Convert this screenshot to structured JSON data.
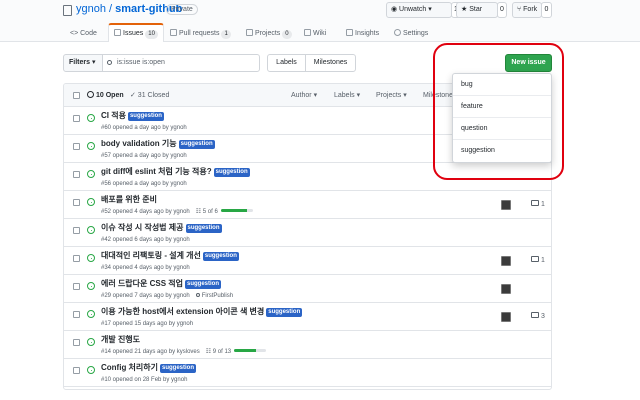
{
  "repo": {
    "owner": "ygnoh",
    "sep": " / ",
    "name": "smart-github",
    "visibility": "Private"
  },
  "header_buttons": {
    "unwatch": "◉ Unwatch ▾",
    "unwatch_count": "1",
    "star": "★ Star",
    "star_count": "0",
    "fork": "⑂ Fork",
    "fork_count": "0"
  },
  "tabs": [
    {
      "label": "<> Code",
      "icon": "code-icon"
    },
    {
      "label": "Issues",
      "count": "10",
      "icon": "issue-icon"
    },
    {
      "label": "Pull requests",
      "count": "1",
      "icon": "pr-icon"
    },
    {
      "label": "Projects",
      "count": "0",
      "icon": "project-icon"
    },
    {
      "label": "Wiki",
      "icon": "wiki-icon"
    },
    {
      "label": "Insights",
      "icon": "graph-icon"
    },
    {
      "label": "Settings",
      "icon": "gear-icon"
    }
  ],
  "toolbar": {
    "filters": "Filters ▾",
    "search_value": "is:issue is:open",
    "labels": "Labels",
    "milestones": "Milestones",
    "new_issue": "New issue"
  },
  "list_header": {
    "open": "10 Open",
    "closed": "✓ 31 Closed",
    "author": "Author ▾",
    "labels": "Labels ▾",
    "projects": "Projects ▾",
    "milestones": "Milestone"
  },
  "issues": [
    {
      "title": "CI 적용",
      "label": "suggestion",
      "meta": "#60 opened a day ago by ygnoh"
    },
    {
      "title": "body validation 기능",
      "label": "suggestion",
      "meta": "#57 opened a day ago by ygnoh"
    },
    {
      "title": "git diff에 eslint 처럼 기능 적용?",
      "label": "suggestion",
      "meta": "#56 opened a day ago by ygnoh"
    },
    {
      "title": "배포를 위한 준비",
      "label": "",
      "meta": "#52 opened 4 days ago by ygnoh",
      "progress": "5 of 6",
      "progress_frac": 0.83,
      "comments": "1"
    },
    {
      "title": "이슈 작성 시 작성법 제공",
      "label": "suggestion",
      "meta": "#42 opened 6 days ago by ygnoh"
    },
    {
      "title": "대대적인 리팩토링 - 설계 개선",
      "label": "suggestion",
      "meta": "#34 opened 4 days ago by ygnoh",
      "comments": "1"
    },
    {
      "title": "에러 드랍다운 CSS 적업",
      "label": "suggestion",
      "meta": "#29 opened 7 days ago by ygnoh",
      "milestone": "FirstPublish"
    },
    {
      "title": "이용 가능한 host에서 extension 아이콘 색 변경",
      "label": "suggestion",
      "meta": "#17 opened 15 days ago by ygnoh",
      "comments": "3"
    },
    {
      "title": "개발 진행도",
      "label": "",
      "meta": "#14 opened 21 days ago by kysloves",
      "progress": "9 of 13",
      "progress_frac": 0.69
    },
    {
      "title": "Config 처리하기",
      "label": "suggestion",
      "meta": "#10 opened on 28 Feb by ygnoh"
    }
  ],
  "label_menu": [
    "bug",
    "feature",
    "question",
    "suggestion"
  ],
  "colors": {
    "label_bg": "#2b64c6",
    "new_issue_green": "#2ea44f",
    "highlight_red": "#e0000f"
  }
}
